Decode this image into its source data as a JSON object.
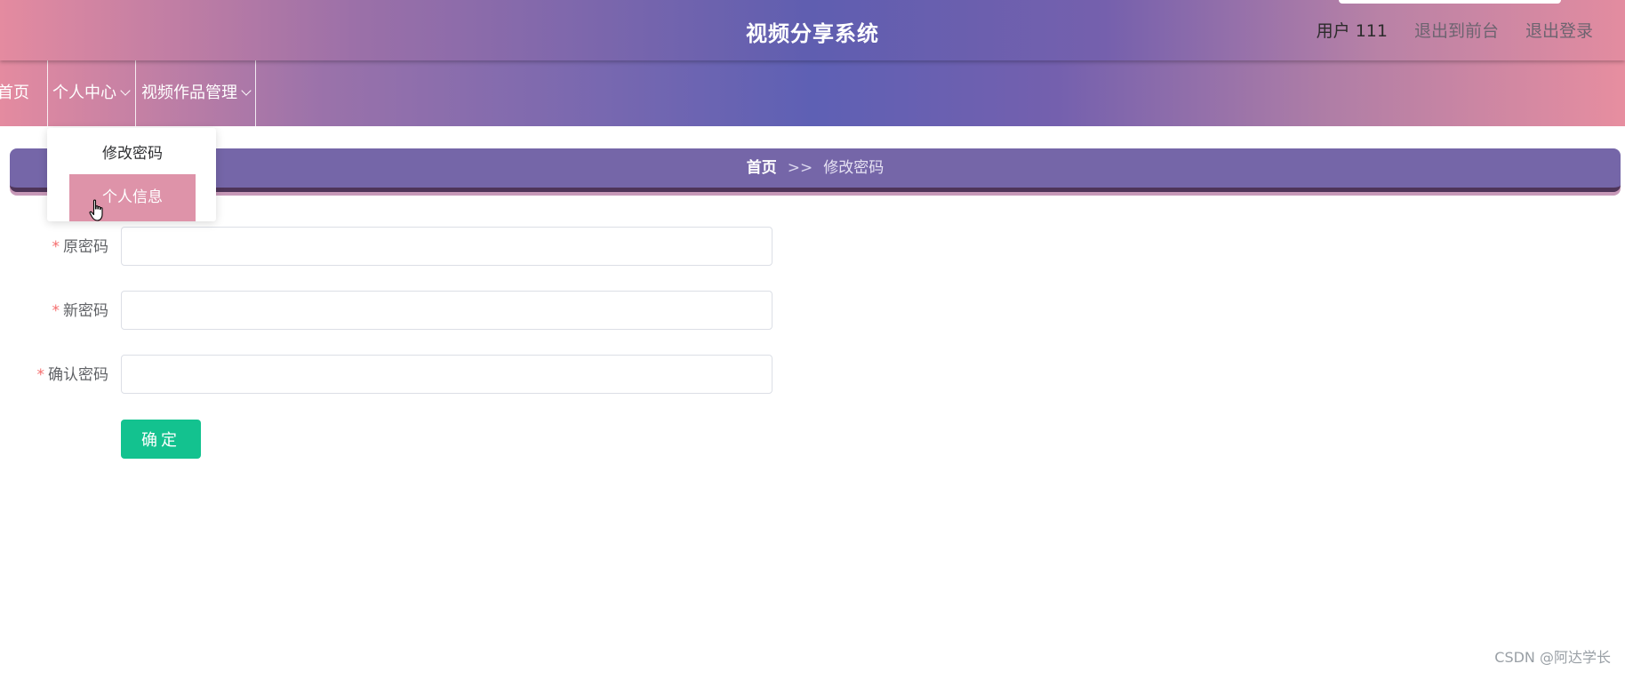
{
  "header": {
    "title": "视频分享系统",
    "user_label": "用户 111",
    "to_frontend": "退出到前台",
    "logout": "退出登录"
  },
  "nav": {
    "home": "首页",
    "personal_center": "个人中心",
    "video_management": "视频作品管理"
  },
  "dropdown": {
    "items": [
      {
        "label": "修改密码",
        "active": false
      },
      {
        "label": "个人信息",
        "active": true
      }
    ]
  },
  "breadcrumb": {
    "home": "首页",
    "separator": ">>",
    "current": "修改密码"
  },
  "form": {
    "fields": [
      {
        "label": "原密码",
        "required": true,
        "value": ""
      },
      {
        "label": "新密码",
        "required": true,
        "value": ""
      },
      {
        "label": "确认密码",
        "required": true,
        "value": ""
      }
    ],
    "submit_label": "确定"
  },
  "watermark": "CSDN @阿达学长",
  "colors": {
    "accent_green": "#13c28f",
    "dropdown_active": "#de93a9",
    "breadcrumb_bg": "#7566a8",
    "required_star": "#f56c6c"
  },
  "icons": {
    "cursor": "hand-pointer-icon",
    "dropdown": "chevron-down-icon"
  }
}
